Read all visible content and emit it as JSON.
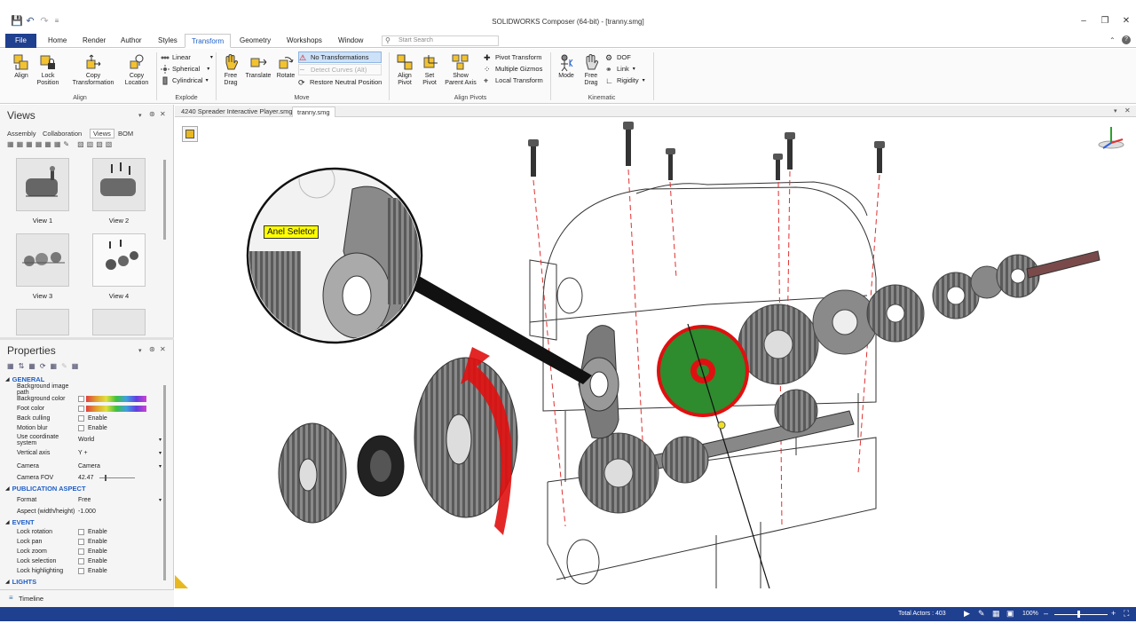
{
  "app": {
    "title": "SOLIDWORKS Composer (64-bit) - [tranny.smg]"
  },
  "menu": {
    "tabs": [
      "File",
      "Home",
      "Render",
      "Author",
      "Styles",
      "Transform",
      "Geometry",
      "Workshops",
      "Window"
    ],
    "active_tab": "Transform",
    "search_placeholder": "Start Search"
  },
  "ribbon": {
    "align_group": {
      "label": "Align",
      "align": "Align",
      "lock_position": "Lock\nPosition",
      "copy_transformation": "Copy\nTransformation",
      "copy_location": "Copy\nLocation"
    },
    "explode_group": {
      "label": "Explode",
      "linear": "Linear",
      "spherical": "Spherical",
      "cylindrical": "Cylindrical"
    },
    "move_group": {
      "label": "Move",
      "free_drag": "Free\nDrag",
      "translate": "Translate",
      "rotate": "Rotate",
      "no_transformations": "No Transformations",
      "detect_curves": "Detect Curves (Alt)",
      "restore_neutral": "Restore Neutral Position"
    },
    "align_pivots_group": {
      "label": "Align Pivots",
      "align_pivot": "Align\nPivot",
      "set_pivot": "Set\nPivot",
      "show_parent_axis": "Show\nParent Axis",
      "pivot_transform": "Pivot Transform",
      "multiple_gizmos": "Multiple Gizmos",
      "local_transform": "Local Transform"
    },
    "kinematic_group": {
      "label": "Kinematic",
      "mode": "Mode",
      "free_drag": "Free\nDrag",
      "dof": "DOF",
      "link": "Link",
      "rigidity": "Rigidity"
    }
  },
  "views_panel": {
    "title": "Views",
    "tabs": [
      "Assembly",
      "Collaboration",
      "Views",
      "BOM"
    ],
    "active_tab": "Views",
    "thumbnails": [
      "View 1",
      "View 2",
      "View 3",
      "View 4"
    ]
  },
  "properties_panel": {
    "title": "Properties",
    "sections": {
      "general": "GENERAL",
      "publication": "PUBLICATION ASPECT",
      "event": "EVENT",
      "lights": "LIGHTS"
    },
    "general_rows": [
      {
        "key": "Background image path",
        "value": ""
      },
      {
        "key": "Background color",
        "value": ""
      },
      {
        "key": "Foot color",
        "value": ""
      },
      {
        "key": "Back culling",
        "value": "Enable"
      },
      {
        "key": "Motion blur",
        "value": "Enable"
      },
      {
        "key": "Use coordinate system",
        "value": "World"
      },
      {
        "key": "Vertical axis",
        "value": "Y +"
      },
      {
        "key": "Camera",
        "value": "Camera"
      },
      {
        "key": "Camera FOV",
        "value": "42.47"
      }
    ],
    "publication_rows": [
      {
        "key": "Format",
        "value": "Free"
      },
      {
        "key": "Aspect (width/height)",
        "value": "-1.000"
      }
    ],
    "event_rows": [
      {
        "key": "Lock rotation",
        "value": "Enable"
      },
      {
        "key": "Lock pan",
        "value": "Enable"
      },
      {
        "key": "Lock zoom",
        "value": "Enable"
      },
      {
        "key": "Lock selection",
        "value": "Enable"
      },
      {
        "key": "Lock highlighting",
        "value": "Enable"
      }
    ]
  },
  "timeline": {
    "label": "Timeline"
  },
  "document_tabs": [
    "4240 Spreader Interactive Player.smg",
    "tranny.smg"
  ],
  "viewport": {
    "callout_label": "Anel Seletor"
  },
  "status": {
    "total_actors": "Total Actors : 403",
    "zoom": "100%"
  },
  "colors": {
    "accent": "#1f3f8f",
    "highlight_green": "#2e8b2e",
    "highlight_red": "#e01010",
    "callout_yellow": "#ffff00"
  }
}
